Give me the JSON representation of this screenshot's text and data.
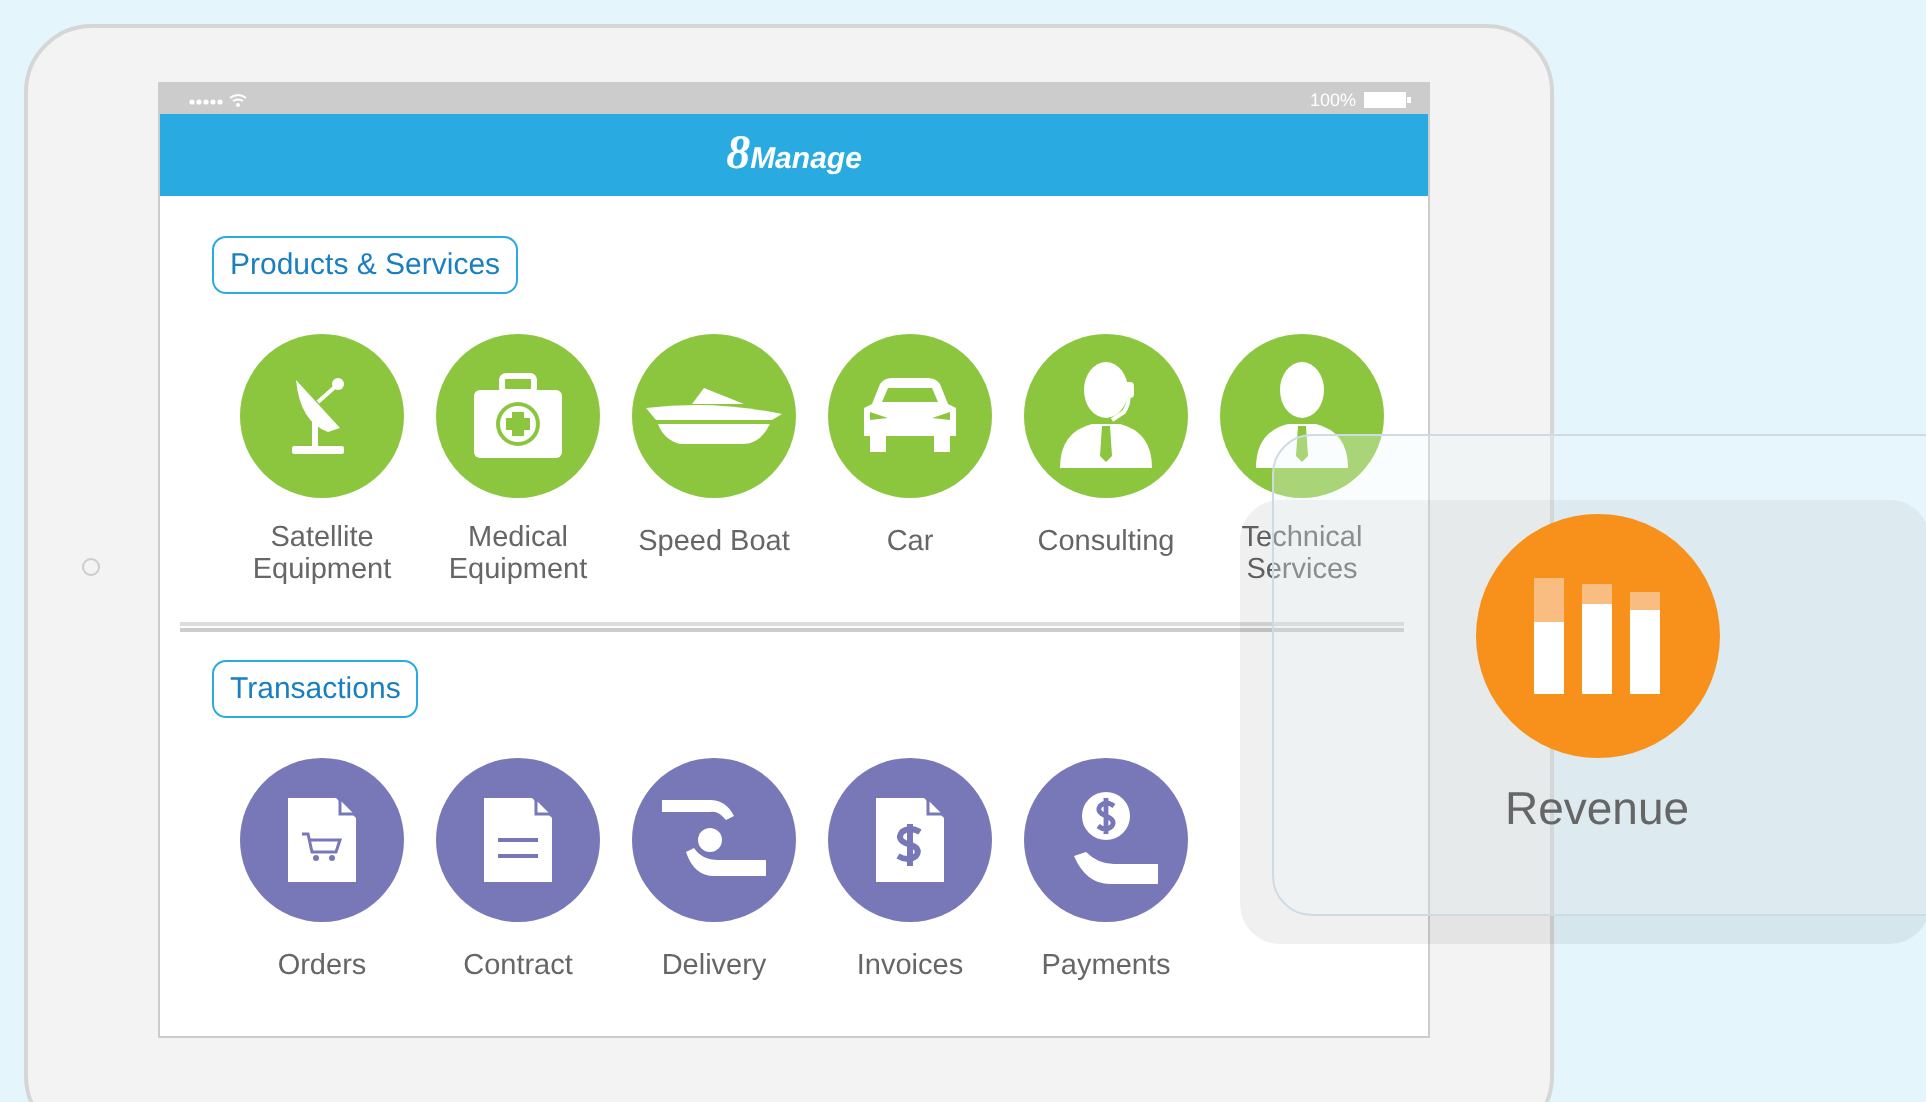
{
  "status_bar": {
    "battery": "100%"
  },
  "header": {
    "logo_mark": "8",
    "logo_text": "Manage"
  },
  "sections": [
    {
      "title": "Products & Services",
      "color": "#8cc63f",
      "items": [
        {
          "label": "Satellite Equipment"
        },
        {
          "label": "Medical Equipment"
        },
        {
          "label": "Speed Boat"
        },
        {
          "label": "Car"
        },
        {
          "label": "Consulting"
        },
        {
          "label": "Technical Services"
        }
      ]
    },
    {
      "title": "Transactions",
      "color": "#7878b8",
      "items": [
        {
          "label": "Orders"
        },
        {
          "label": "Contract"
        },
        {
          "label": "Delivery"
        },
        {
          "label": "Invoices"
        },
        {
          "label": "Payments"
        }
      ]
    }
  ],
  "overlay_card": {
    "label": "Revenue",
    "color": "#f7911b"
  }
}
